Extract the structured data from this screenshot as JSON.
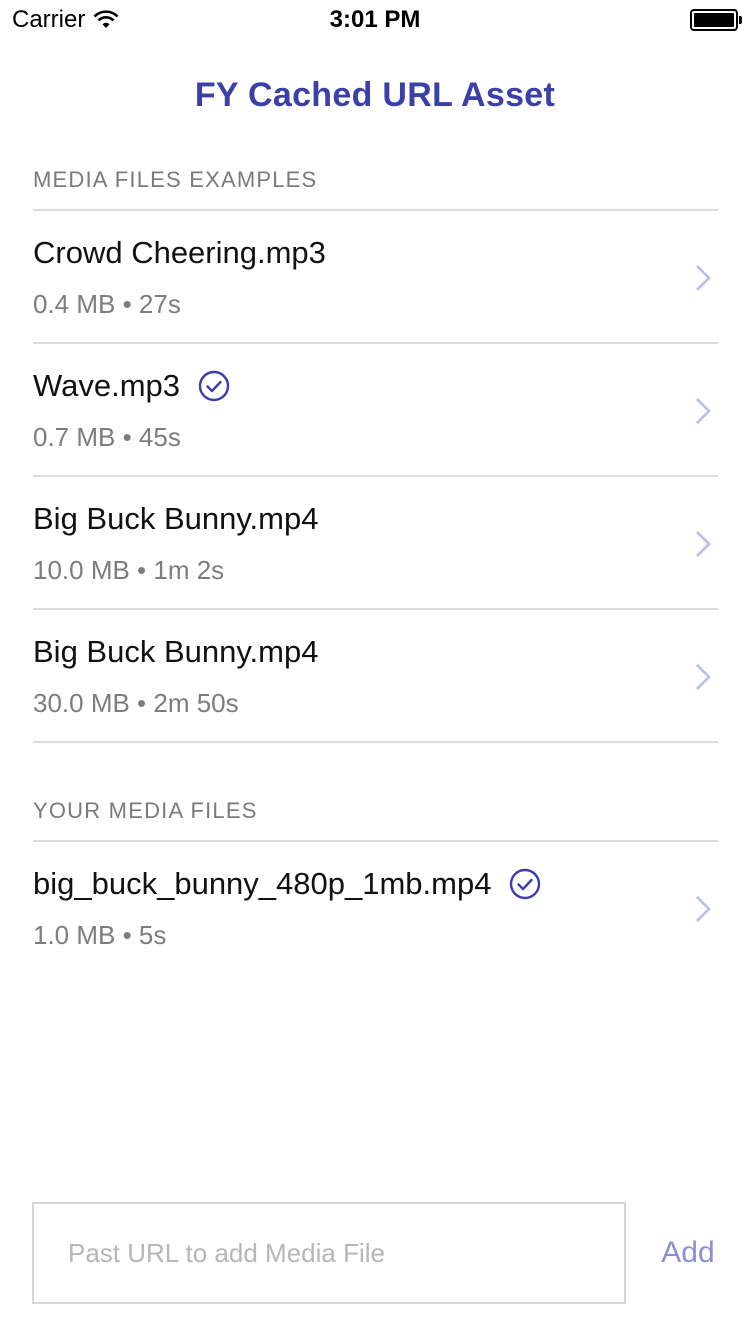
{
  "status_bar": {
    "carrier": "Carrier",
    "time": "3:01 PM",
    "icons": [
      "wifi-icon",
      "battery-icon"
    ]
  },
  "title": "FY Cached URL Asset",
  "colors": {
    "accent": "#3b3fa8",
    "accent_light": "#8a8ed6",
    "chevron": "#b8baf0",
    "separator": "#dcdcdc",
    "secondary_text": "#7d7d7d"
  },
  "sections": [
    {
      "header": "MEDIA FILES EXAMPLES",
      "items": [
        {
          "title": "Crowd Cheering.mp3",
          "subtitle": "0.4 MB • 27s",
          "cached": false
        },
        {
          "title": "Wave.mp3",
          "subtitle": "0.7 MB • 45s",
          "cached": true
        },
        {
          "title": "Big Buck Bunny.mp4",
          "subtitle": "10.0 MB • 1m 2s",
          "cached": false
        },
        {
          "title": "Big Buck Bunny.mp4",
          "subtitle": "30.0 MB • 2m 50s",
          "cached": false
        }
      ]
    },
    {
      "header": "YOUR MEDIA FILES",
      "items": [
        {
          "title": "big_buck_bunny_480p_1mb.mp4",
          "subtitle": "1.0 MB • 5s",
          "cached": true
        }
      ]
    }
  ],
  "footer": {
    "input_placeholder": "Past URL to add Media File",
    "input_value": "",
    "add_label": "Add"
  }
}
